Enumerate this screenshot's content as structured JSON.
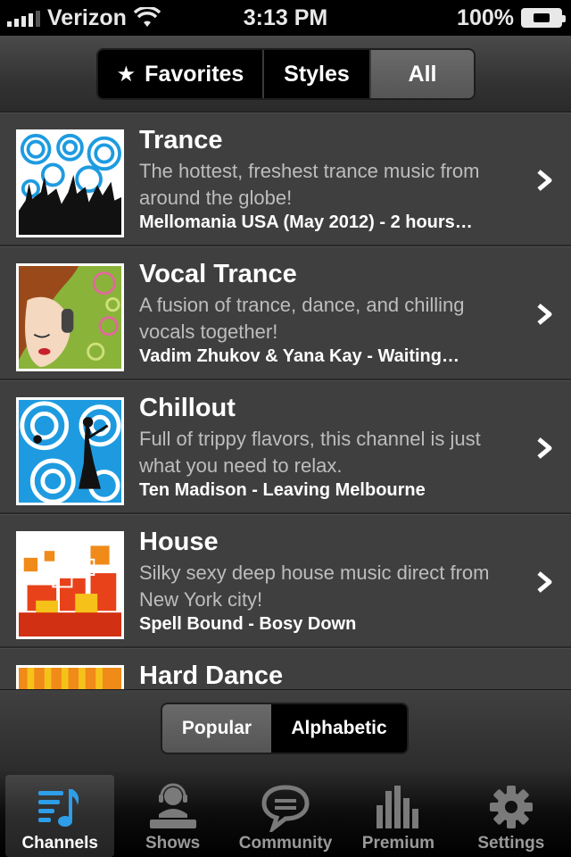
{
  "status_bar": {
    "carrier": "Verizon",
    "time": "3:13 PM",
    "battery": "100%"
  },
  "top_segment": {
    "items": [
      {
        "label": "Favorites",
        "icon": "star-icon"
      },
      {
        "label": "Styles"
      },
      {
        "label": "All"
      }
    ],
    "selected": "All"
  },
  "channels": [
    {
      "title": "Trance",
      "description": "The hottest, freshest trance music from around the globe!",
      "now_playing": "Mellomania USA (May 2012) - 2 hours…"
    },
    {
      "title": "Vocal Trance",
      "description": "A fusion of trance, dance, and chilling vocals together!",
      "now_playing": "Vadim Zhukov & Yana Kay - Waiting…"
    },
    {
      "title": "Chillout",
      "description": "Full of trippy flavors, this channel is just what you need to relax.",
      "now_playing": "Ten Madison - Leaving Melbourne"
    },
    {
      "title": "House",
      "description": "Silky sexy deep house music direct from New York city!",
      "now_playing": "Spell Bound - Bosy Down"
    },
    {
      "title": "Hard Dance",
      "description": "",
      "now_playing": ""
    }
  ],
  "sort_segment": {
    "items": [
      "Popular",
      "Alphabetic"
    ],
    "selected": "Popular"
  },
  "tabs": [
    {
      "label": "Channels",
      "icon": "channels-icon",
      "active": true
    },
    {
      "label": "Shows",
      "icon": "dj-icon",
      "active": false
    },
    {
      "label": "Community",
      "icon": "chat-bubble-icon",
      "active": false
    },
    {
      "label": "Premium",
      "icon": "equalizer-icon",
      "active": false
    },
    {
      "label": "Settings",
      "icon": "gear-icon",
      "active": false
    }
  ],
  "colors": {
    "accent_blue": "#1e9be0",
    "list_background": "#3f3f3f"
  }
}
